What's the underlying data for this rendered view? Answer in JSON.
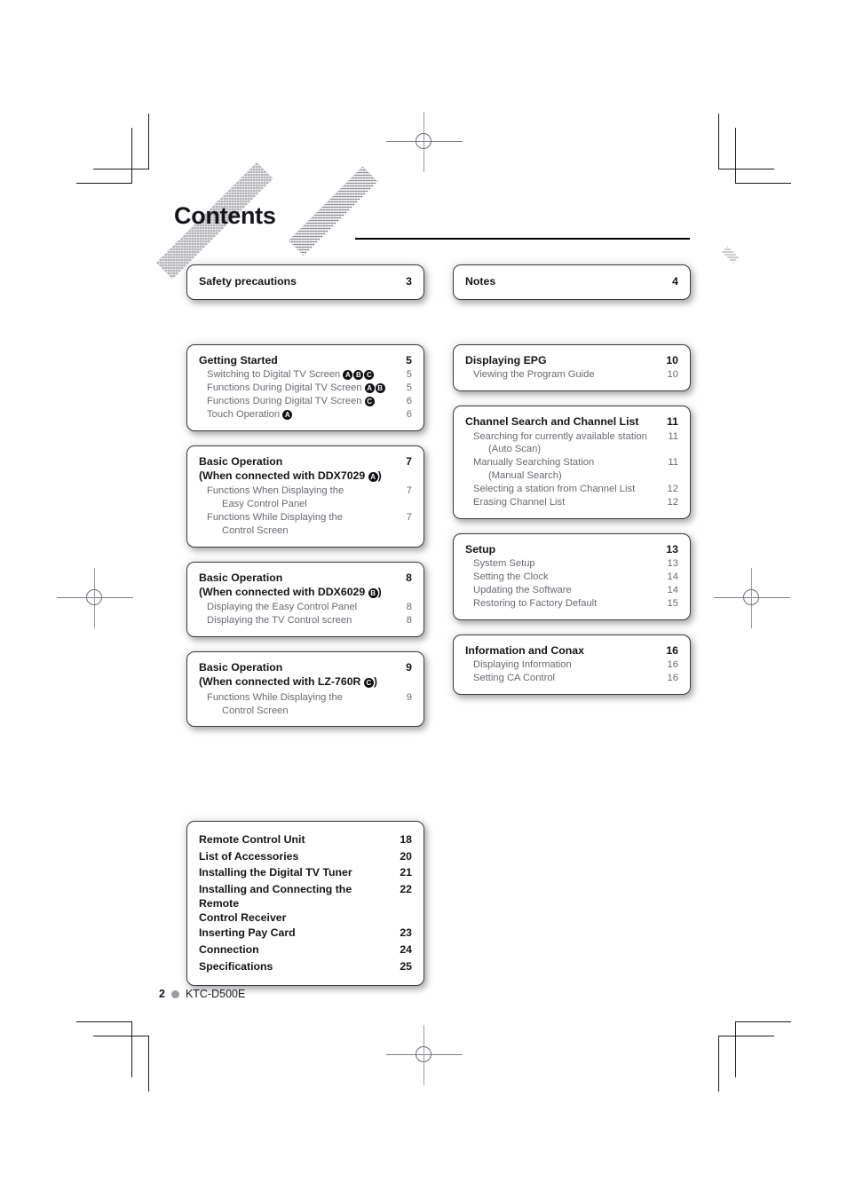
{
  "page": {
    "title": "Contents",
    "footer": {
      "page_number": "2",
      "model": "KTC-D500E"
    }
  },
  "top_boxes": [
    {
      "label": "Safety precautions",
      "page": "3"
    },
    {
      "label": "Notes",
      "page": "4"
    }
  ],
  "left_column": [
    {
      "heading": "Getting Started",
      "heading_page": "5",
      "entries": [
        {
          "label": "Switching to Digital TV Screen",
          "badges": [
            "A",
            "B",
            "C"
          ],
          "page": "5"
        },
        {
          "label": "Functions During Digital TV Screen",
          "badges": [
            "A",
            "B"
          ],
          "page": "5"
        },
        {
          "label": "Functions During Digital TV Screen",
          "badges": [
            "C"
          ],
          "page": "6"
        },
        {
          "label": "Touch Operation",
          "badges": [
            "A"
          ],
          "page": "6"
        }
      ]
    },
    {
      "heading": "Basic Operation",
      "heading_line2": "(When connected with DDX7029",
      "heading_badge": "A",
      "heading_line2_tail": ")",
      "heading_page": "7",
      "entries": [
        {
          "label": "Functions When Displaying the",
          "continuation": "Easy Control Panel",
          "page": "7"
        },
        {
          "label": "Functions While Displaying the",
          "continuation": "Control Screen",
          "page": "7"
        }
      ]
    },
    {
      "heading": "Basic Operation",
      "heading_line2": "(When connected with DDX6029",
      "heading_badge": "B",
      "heading_line2_tail": ")",
      "heading_page": "8",
      "entries": [
        {
          "label": "Displaying the Easy Control Panel",
          "page": "8"
        },
        {
          "label": "Displaying the TV Control screen",
          "page": "8"
        }
      ]
    },
    {
      "heading": "Basic Operation",
      "heading_line2": "(When connected with LZ-760R",
      "heading_badge": "C",
      "heading_line2_tail": ")",
      "heading_page": "9",
      "entries": [
        {
          "label": "Functions While Displaying the",
          "continuation": "Control Screen",
          "page": "9"
        }
      ]
    }
  ],
  "right_column": [
    {
      "heading": "Displaying EPG",
      "heading_page": "10",
      "entries": [
        {
          "label": "Viewing the Program Guide",
          "page": "10"
        }
      ]
    },
    {
      "heading": "Channel Search and Channel List",
      "heading_page": "11",
      "entries": [
        {
          "label": "Searching for currently available station",
          "continuation": "(Auto Scan)",
          "page": "11"
        },
        {
          "label": "Manually Searching Station",
          "continuation": "(Manual Search)",
          "page": "11"
        },
        {
          "label": "Selecting a station from Channel List",
          "page": "12"
        },
        {
          "label": "Erasing Channel List",
          "page": "12"
        }
      ]
    },
    {
      "heading": "Setup",
      "heading_page": "13",
      "entries": [
        {
          "label": "System Setup",
          "page": "13"
        },
        {
          "label": "Setting the Clock",
          "page": "14"
        },
        {
          "label": "Updating the Software",
          "page": "14"
        },
        {
          "label": "Restoring to Factory Default",
          "page": "15"
        }
      ]
    },
    {
      "heading": "Information and Conax",
      "heading_page": "16",
      "entries": [
        {
          "label": "Displaying Information",
          "page": "16"
        },
        {
          "label": "Setting CA Control",
          "page": "16"
        }
      ]
    }
  ],
  "bottom_box": [
    {
      "label": "Remote Control Unit",
      "page": "18"
    },
    {
      "label": "List of Accessories",
      "page": "20"
    },
    {
      "label": "Installing the Digital TV Tuner",
      "page": "21"
    },
    {
      "label": "Installing and Connecting the Remote",
      "continuation": "Control Receiver",
      "page": "22"
    },
    {
      "label": "Inserting Pay Card",
      "page": "23"
    },
    {
      "label": "Connection",
      "page": "24"
    },
    {
      "label": "Specifications",
      "page": "25"
    }
  ]
}
